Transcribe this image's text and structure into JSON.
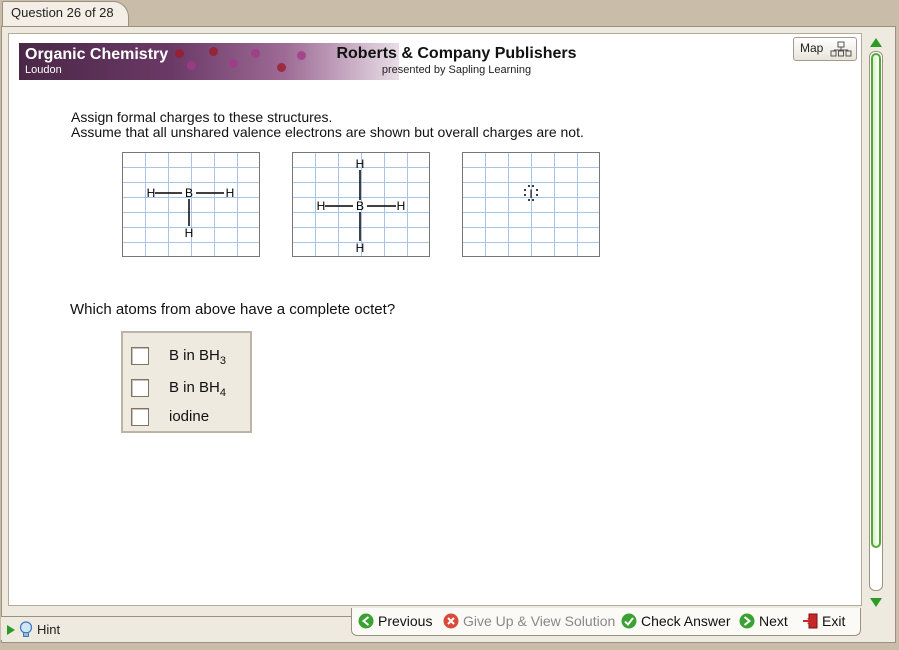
{
  "tab": {
    "label": "Question 26 of 28"
  },
  "banner": {
    "course": "Organic Chemistry",
    "author": "Loudon",
    "publisher": "Roberts & Company Publishers",
    "presented_by": "presented by Sapling Learning"
  },
  "map_button": {
    "label": "Map",
    "icon": "site-map-icon"
  },
  "instructions": {
    "line1": "Assign formal charges to these structures.",
    "line2": "Assume that all unshared valence electrons are shown but overall charges are not."
  },
  "structures": [
    {
      "name": "BH3",
      "atoms": [
        "H",
        "B",
        "H",
        "H"
      ]
    },
    {
      "name": "BH4",
      "atoms": [
        "H",
        "H",
        "B",
        "H",
        "H"
      ]
    },
    {
      "name": "iodine",
      "atoms": [
        "I"
      ]
    }
  ],
  "question": "Which atoms from above have a complete octet?",
  "choices": [
    {
      "prefix": "B in BH",
      "sub": "3",
      "checked": false
    },
    {
      "prefix": "B in BH",
      "sub": "4",
      "checked": false
    },
    {
      "prefix": "iodine",
      "sub": "",
      "checked": false
    }
  ],
  "footer": {
    "hint": "Hint",
    "previous": "Previous",
    "give_up": "Give Up & View Solution",
    "check_answer": "Check Answer",
    "next": "Next",
    "exit": "Exit"
  },
  "colors": {
    "accent_green": "#2c9a24",
    "grid_line": "#a9c4e4",
    "banner_purple": "#4a2747"
  }
}
